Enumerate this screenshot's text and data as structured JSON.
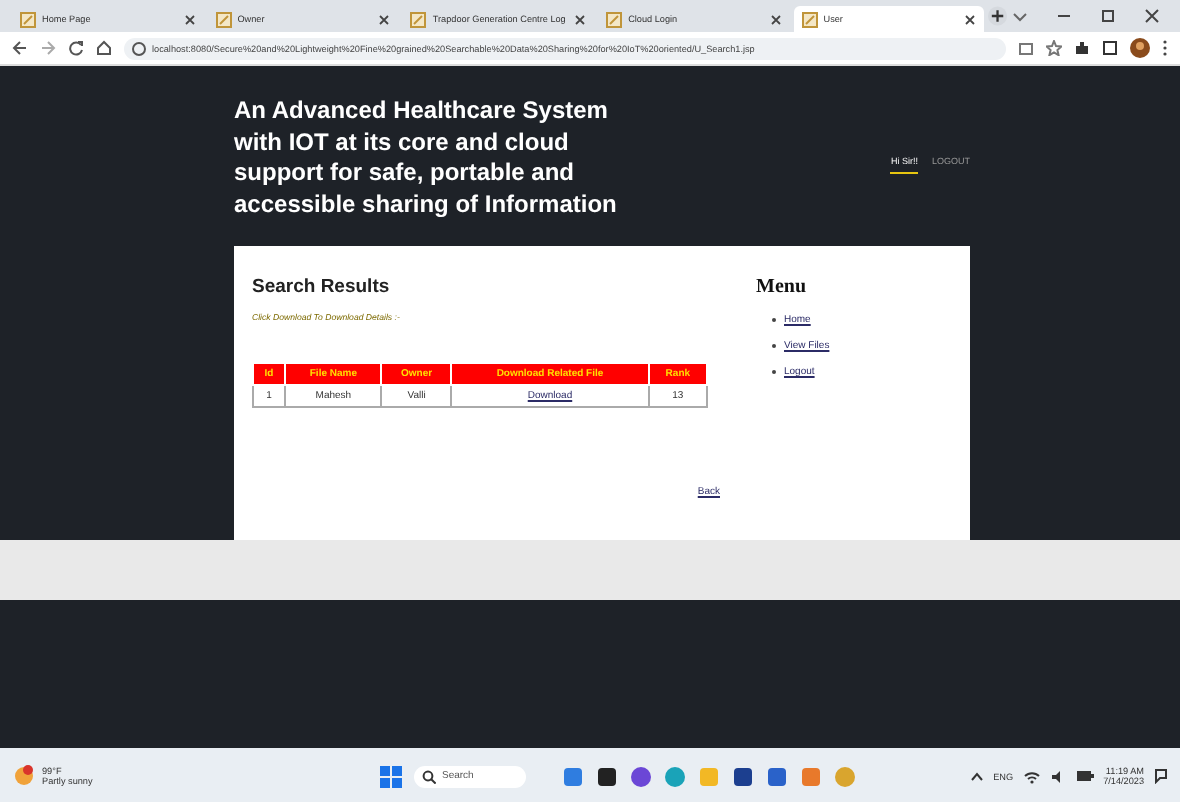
{
  "browser": {
    "tabs": [
      {
        "label": "Home Page",
        "selected": false
      },
      {
        "label": "Owner",
        "selected": false
      },
      {
        "label": "Trapdoor Generation Centre Log",
        "selected": false
      },
      {
        "label": "Cloud Login",
        "selected": false
      },
      {
        "label": "User",
        "selected": true
      }
    ],
    "address": "localhost:8080/Secure%20and%20Lightweight%20Fine%20grained%20Searchable%20Data%20Sharing%20for%20IoT%20oriented/U_Search1.jsp"
  },
  "header": {
    "title": "An Advanced Healthcare System with IOT at its core and cloud support for safe, portable and accessible sharing of Information",
    "nav": [
      {
        "label": "Hi Sir!!",
        "selected": true
      },
      {
        "label": "LOGOUT",
        "selected": false
      }
    ]
  },
  "content": {
    "heading": "Search Results",
    "hint": "Click Download To Download Details :-",
    "table": {
      "columns": [
        "Id",
        "File Name",
        "Owner",
        "Download Related File",
        "Rank"
      ],
      "rows": [
        [
          "1",
          "Mahesh",
          "Valli",
          "Download",
          "13"
        ]
      ]
    },
    "back": "Back"
  },
  "menu": {
    "heading": "Menu",
    "items": [
      "Home",
      "View Files",
      "Logout"
    ]
  },
  "taskbar": {
    "weather": {
      "temp": "99°F",
      "condition": "Partly sunny"
    },
    "search": "Search",
    "language": "ENG",
    "time": "11:19 AM",
    "date": "7/14/2023"
  }
}
